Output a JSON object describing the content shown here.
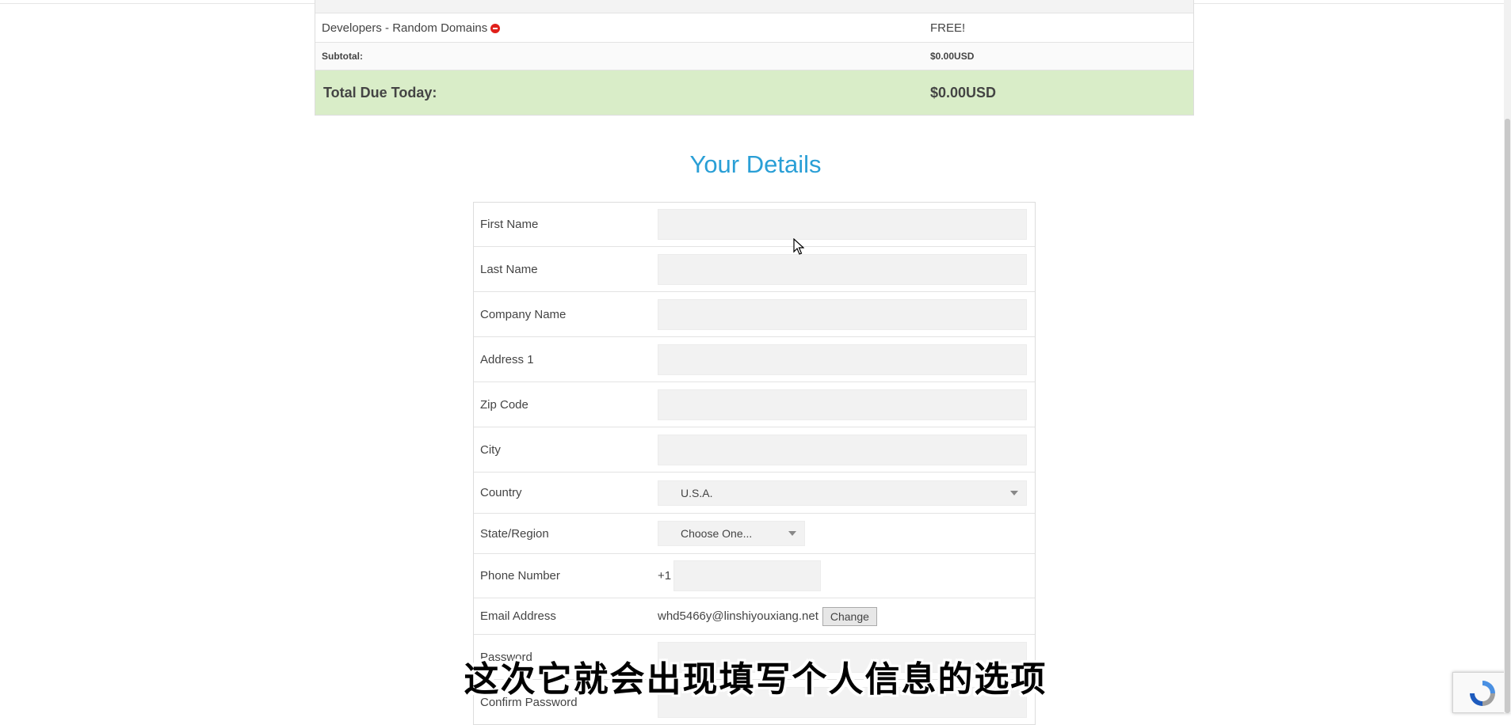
{
  "order_summary": {
    "item": {
      "name": "Developers - Random Domains",
      "price": "FREE!"
    },
    "subtotal": {
      "label": "Subtotal:",
      "value": "$0.00USD"
    },
    "total": {
      "label": "Total Due Today:",
      "value": "$0.00USD"
    }
  },
  "details": {
    "title": "Your Details",
    "fields": {
      "first_name": {
        "label": "First Name",
        "value": ""
      },
      "last_name": {
        "label": "Last Name",
        "value": ""
      },
      "company_name": {
        "label": "Company Name",
        "value": ""
      },
      "address1": {
        "label": "Address 1",
        "value": ""
      },
      "zip": {
        "label": "Zip Code",
        "value": ""
      },
      "city": {
        "label": "City",
        "value": ""
      },
      "country": {
        "label": "Country",
        "selected": "U.S.A."
      },
      "state": {
        "label": "State/Region",
        "selected": "Choose One..."
      },
      "phone": {
        "label": "Phone Number",
        "prefix": "+1",
        "value": ""
      },
      "email": {
        "label": "Email Address",
        "value": "whd5466y@linshiyouxiang.net",
        "change_label": "Change"
      },
      "password": {
        "label": "Password",
        "value": ""
      },
      "confirm_password": {
        "label": "Confirm Password",
        "value": ""
      }
    }
  },
  "video_subtitle": "这次它就会出现填写个人信息的选项",
  "colors": {
    "accent": "#2a9fd6",
    "total_bg": "#d9edc8",
    "remove": "#e0201b"
  },
  "icons": [
    "remove-icon",
    "dropdown-caret-icon",
    "mouse-cursor-icon",
    "recaptcha-icon"
  ]
}
